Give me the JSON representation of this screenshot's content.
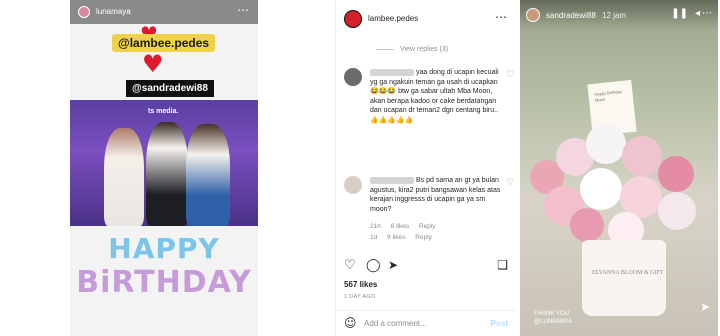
{
  "story_left": {
    "username": "lunamaya",
    "tag_primary": "@lambee.pedes",
    "tag_secondary": "@sandradewi88",
    "photo_logo": "ts media.",
    "birthday_line1": "HAPPY",
    "birthday_line2": "BiRTHDAY"
  },
  "post": {
    "username": "lambee.pedes",
    "view_replies": "View replies (3)",
    "comments": [
      {
        "text": "yaa dong di ucapin kecuali yg ga ngakuin teman ga usah di ucapkan 😂😂😂 btw ga sabar ultah Mba Moon, akan berapa kadoo or cake berdatangan dan ucapan dr teman2 dgn centang biru.. 👍👍👍👍👍",
        "time": "21h",
        "likes": "6 likes",
        "reply": "Reply"
      },
      {
        "text": "Bs pd sama an gt ya bulan agustus, kira2 putri bangsawan kelas atas kerajan inggresss di ucapin ga ya sm moon?",
        "time": "1d",
        "likes": "9 likes",
        "reply": "Reply"
      }
    ],
    "like_count": "567 likes",
    "posted_ago": "1 DAY AGO",
    "add_comment_placeholder": "Add a comment...",
    "post_button": "Post"
  },
  "story_right": {
    "username": "sandradewi88",
    "time": "12 jam",
    "box_text": "ELVANNA BLOOM & GIFT",
    "card_text": "Happy Birthday Moon",
    "caption_line1": "THANK YOU",
    "caption_line2": "@LUNAMAYA"
  },
  "colors": {
    "accent_red": "#e0182c",
    "ig_text": "#262626",
    "ig_muted": "#8e8e8e",
    "post_button": "#b2dffc"
  }
}
